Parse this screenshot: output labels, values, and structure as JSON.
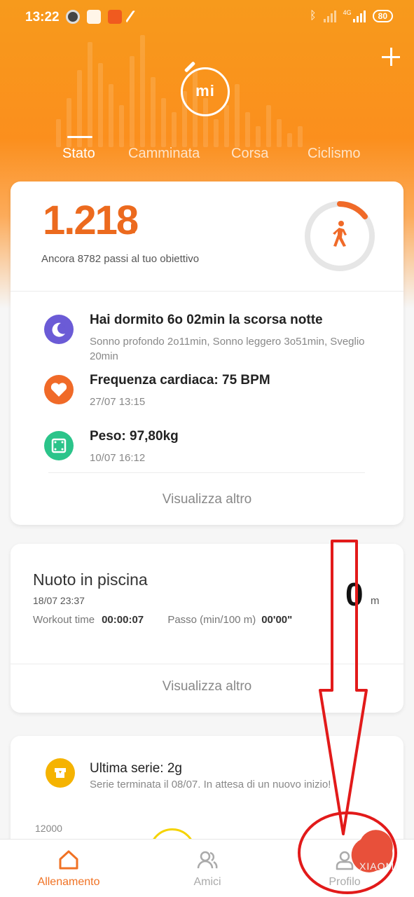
{
  "status_bar": {
    "time": "13:22",
    "network": "4G",
    "battery": "80",
    "icons": [
      "camera-notification-icon",
      "mail-icon",
      "app-notification-icon",
      "clean-icon",
      "bluetooth-icon",
      "signal-icon"
    ]
  },
  "header": {
    "logo": "mi",
    "tabs": [
      "Stato",
      "Camminata",
      "Corsa",
      "Ciclismo"
    ],
    "active_tab": "Stato",
    "colors": {
      "accent": "#fb8f1d",
      "text_accent": "#ec6a1e"
    }
  },
  "steps_card": {
    "steps": "1.218",
    "remaining": "Ancora 8782 passi al tuo obiettivo",
    "rows": [
      {
        "icon": "sleep-icon",
        "title": "Hai dormito 6o 02min la scorsa notte",
        "sub": "Sonno profondo 2o11min, Sonno leggero 3o51min, Sveglio 20min",
        "color": "#6b5bd6"
      },
      {
        "icon": "heart-icon",
        "title": "Frequenza cardiaca: 75 BPM",
        "sub": "27/07 13:15",
        "color": "#f06a28"
      },
      {
        "icon": "weight-icon",
        "title": "Peso: 97,80kg",
        "sub": "10/07 16:12",
        "color": "#2bc48a"
      }
    ],
    "more": "Visualizza altro"
  },
  "swim_card": {
    "title": "Nuoto in piscina",
    "date": "18/07 23:37",
    "workout_label": "Workout time",
    "workout_value": "00:00:07",
    "pace_label": "Passo (min/100 m)",
    "pace_value": "00'00\"",
    "distance": "0",
    "unit": "m",
    "more": "Visualizza altro"
  },
  "streak_card": {
    "title": "Ultima serie: 2g",
    "sub": "Serie terminata il 08/07. In attesa di un nuovo inizio!",
    "y_label": "12000"
  },
  "nav": {
    "items": [
      "Allenamento",
      "Amici",
      "Profilo"
    ],
    "active": "Allenamento"
  },
  "watermark": "XIAOMI"
}
